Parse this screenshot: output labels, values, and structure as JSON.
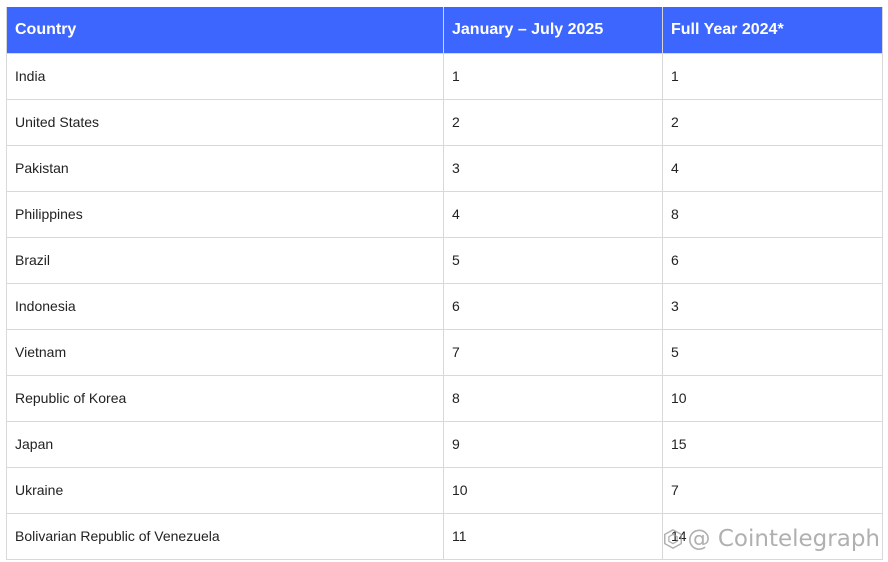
{
  "table": {
    "headers": [
      "Country",
      "January – July 2025",
      "Full Year 2024*"
    ],
    "rows": [
      [
        "India",
        "1",
        "1"
      ],
      [
        "United States",
        "2",
        "2"
      ],
      [
        "Pakistan",
        "3",
        "4"
      ],
      [
        "Philippines",
        "4",
        "8"
      ],
      [
        "Brazil",
        "5",
        "6"
      ],
      [
        "Indonesia",
        "6",
        "3"
      ],
      [
        "Vietnam",
        "7",
        "5"
      ],
      [
        "Republic of Korea",
        "8",
        "10"
      ],
      [
        "Japan",
        "9",
        "15"
      ],
      [
        "Ukraine",
        "10",
        "7"
      ],
      [
        "Bolivarian Republic of Venezuela",
        "11",
        "14"
      ]
    ]
  },
  "watermark": {
    "text": "@ Cointelegraph"
  },
  "colors": {
    "header_bg": "#3d66ff",
    "header_text": "#ffffff",
    "border": "#d9d9d9"
  }
}
